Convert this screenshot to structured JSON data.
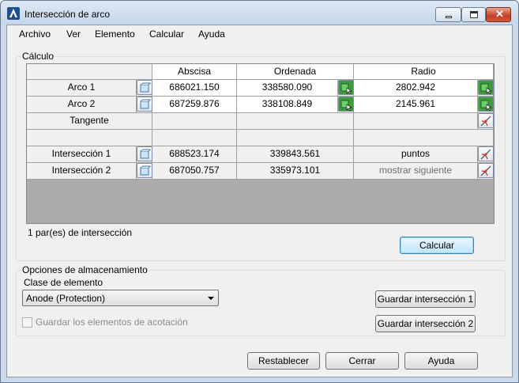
{
  "window": {
    "title": "Intersección de arco"
  },
  "menu": [
    "Archivo",
    "Ver",
    "Elemento",
    "Calcular",
    "Ayuda"
  ],
  "calc_group": {
    "label": "Cálculo"
  },
  "grid": {
    "headers": [
      "Abscisa",
      "Ordenada",
      "Radio"
    ],
    "rows": [
      {
        "label": "Arco 1",
        "abscisa": "686021.150",
        "ordenada": "338580.090",
        "radio": "2802.942"
      },
      {
        "label": "Arco 2",
        "abscisa": "687259.876",
        "ordenada": "338108.849",
        "radio": "2145.961"
      },
      {
        "label": "Tangente",
        "abscisa": "",
        "ordenada": "",
        "radio": ""
      },
      {
        "label": "",
        "abscisa": "",
        "ordenada": "",
        "radio": ""
      },
      {
        "label": "Intersección 1",
        "abscisa": "688523.174",
        "ordenada": "339843.561",
        "radio": "puntos"
      },
      {
        "label": "Intersección 2",
        "abscisa": "687050.757",
        "ordenada": "335973.101",
        "radio": "mostrar siguiente"
      }
    ]
  },
  "status": "1 par(es) de intersección",
  "buttons": {
    "calcular": "Calcular",
    "guardar1": "Guardar intersección 1",
    "guardar2": "Guardar intersección 2",
    "restablecer": "Restablecer",
    "cerrar": "Cerrar",
    "ayuda": "Ayuda"
  },
  "storage": {
    "label": "Opciones de almacenamiento",
    "class_label": "Clase de elemento",
    "class_value": "Anode (Protection)",
    "checkbox_label": "Guardar los elementos de acotación"
  },
  "icons": {
    "pick_point": "pick-point-icon",
    "pick_element": "pick-element-icon",
    "tangent": "tangent-icon"
  },
  "colors": {
    "accent": "#3c7fb1",
    "pick_green": "#3f9b3f"
  }
}
